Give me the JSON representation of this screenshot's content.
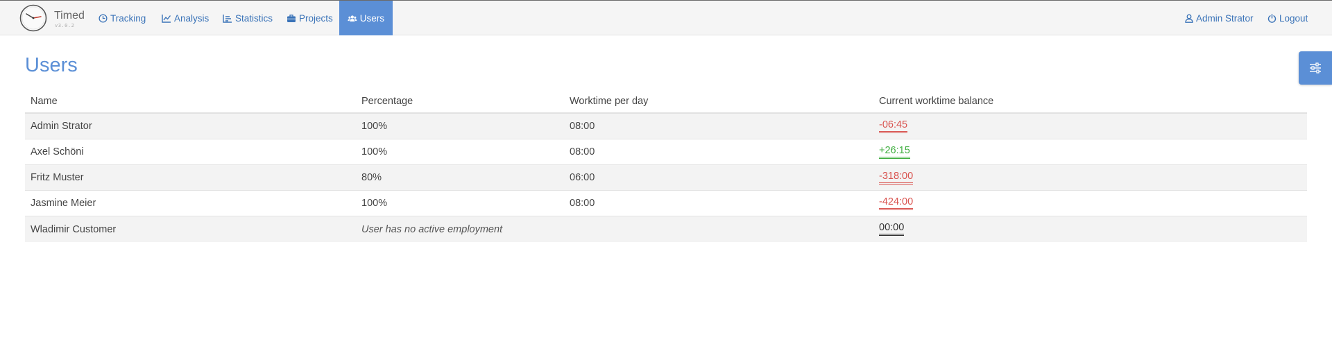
{
  "app": {
    "name": "Timed",
    "version": "v3.0.2"
  },
  "nav": {
    "items": [
      {
        "label": "Tracking",
        "icon": "clock-icon"
      },
      {
        "label": "Analysis",
        "icon": "line-chart-icon"
      },
      {
        "label": "Statistics",
        "icon": "bar-chart-icon"
      },
      {
        "label": "Projects",
        "icon": "briefcase-icon"
      },
      {
        "label": "Users",
        "icon": "users-icon",
        "active": true
      }
    ],
    "user_label": "Admin Strator",
    "logout_label": "Logout"
  },
  "page": {
    "title": "Users"
  },
  "table": {
    "headers": [
      "Name",
      "Percentage",
      "Worktime per day",
      "Current worktime balance"
    ],
    "rows": [
      {
        "name": "Admin Strator",
        "percentage": "100%",
        "worktime": "08:00",
        "balance": "-06:45",
        "status": "negative"
      },
      {
        "name": "Axel Schöni",
        "percentage": "100%",
        "worktime": "08:00",
        "balance": "+26:15",
        "status": "positive"
      },
      {
        "name": "Fritz Muster",
        "percentage": "80%",
        "worktime": "06:00",
        "balance": "-318:00",
        "status": "negative"
      },
      {
        "name": "Jasmine Meier",
        "percentage": "100%",
        "worktime": "08:00",
        "balance": "-424:00",
        "status": "negative"
      },
      {
        "name": "Wladimir Customer",
        "percentage": "User has no active employment",
        "worktime": "",
        "balance": "00:00",
        "status": "zero"
      }
    ]
  },
  "colors": {
    "accent": "#5b8fd6",
    "link": "#3a73b8",
    "negative": "#d9534f",
    "positive": "#3fae3f",
    "neutral": "#333333"
  },
  "filter_button": {
    "icon": "sliders-icon"
  }
}
